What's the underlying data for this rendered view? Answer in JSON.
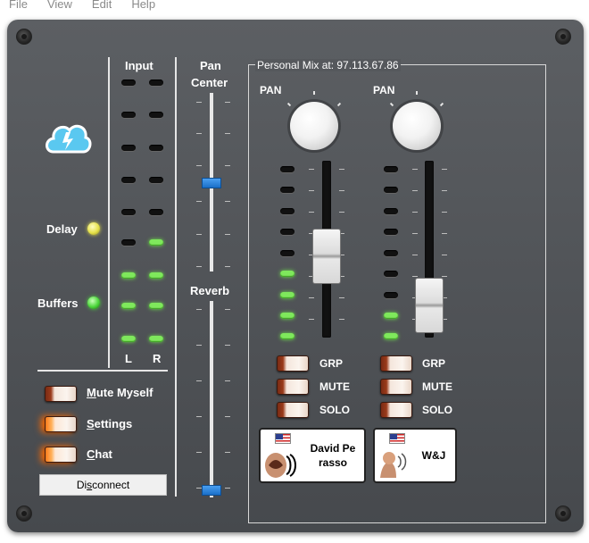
{
  "menu": {
    "items": [
      "File",
      "View",
      "Edit",
      "Help"
    ]
  },
  "input_section": {
    "label": "Input",
    "left_label": "L",
    "right_label": "R"
  },
  "pan_section": {
    "title_line1": "Pan",
    "title_line2": "Center"
  },
  "reverb_section": {
    "label": "Reverb"
  },
  "status": {
    "delay_label": "Delay",
    "buffers_label": "Buffers",
    "delay_color": "#e6e24a",
    "buffers_color": "#4bd63a"
  },
  "buttons": {
    "mute_myself_prefix": "M",
    "mute_myself_rest": "ute Myself",
    "settings_prefix": "S",
    "settings_rest": "ettings",
    "chat_prefix": "C",
    "chat_rest": "hat",
    "disconnect_prefix": "Di",
    "disconnect_u": "s",
    "disconnect_rest": "connect"
  },
  "personal_mix": {
    "legend": "Personal Mix at: 97.113.67.86",
    "channels": [
      {
        "pan_label": "PAN",
        "grp": "GRP",
        "mute": "MUTE",
        "solo": "SOLO",
        "name_line1": "David Pe",
        "name_line2": "rasso"
      },
      {
        "pan_label": "PAN",
        "grp": "GRP",
        "mute": "MUTE",
        "solo": "SOLO",
        "name_line1": "W&J",
        "name_line2": ""
      }
    ]
  },
  "colors": {
    "panel": "#505357",
    "led_on": "#7fe85c",
    "fader_handle": "#1a6fc8",
    "toggle_glow": "#ff6a00"
  },
  "icons": [
    "cloud-logo-icon",
    "flag-usa-icon",
    "avatar-icon"
  ]
}
